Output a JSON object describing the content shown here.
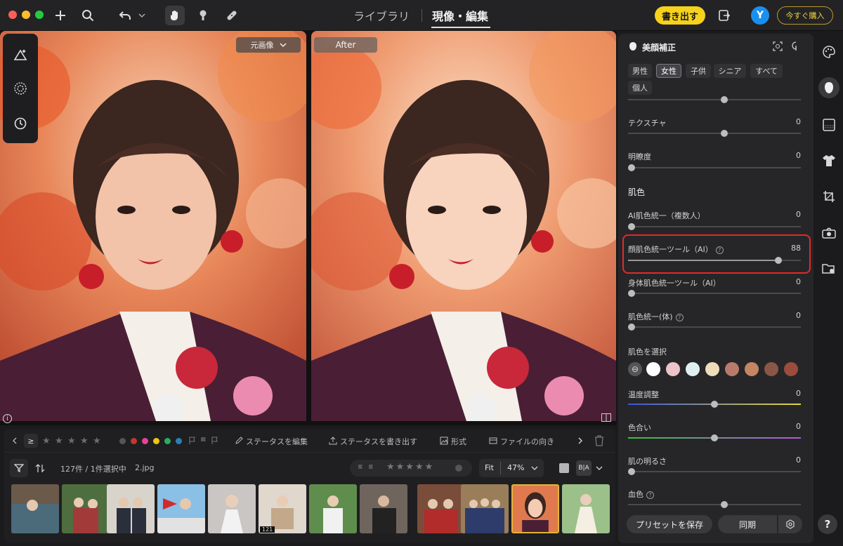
{
  "topbar": {
    "nav_library": "ライブラリ",
    "nav_develop": "現像・編集",
    "export_label": "書き出す",
    "avatar_letter": "Y",
    "buy_label": "今すぐ購入"
  },
  "viewer": {
    "original_dropdown": "元画像",
    "after_label": "After"
  },
  "filmstrip": {
    "edit_status": "ステータスを編集",
    "export_status": "ステータスを書き出す",
    "format": "形式",
    "file_orientation": "ファイルの向き",
    "count_text": "127件 / 1件選択中",
    "file_name": "2.jpg",
    "fit_label": "Fit",
    "zoom_value": "47%",
    "ba_label": "B|A",
    "thumb_badge": "121",
    "color_labels": [
      "#c0392b",
      "#e84393",
      "#f1c40f",
      "#27ae60",
      "#2980b9"
    ]
  },
  "panel": {
    "title": "美顔補正",
    "chips": [
      "男性",
      "女性",
      "子供",
      "シニア",
      "すべて",
      "個人"
    ],
    "active_chip": "女性",
    "texture_label": "テクスチャ",
    "texture_value": "0",
    "clarity_label": "明瞭度",
    "clarity_value": "0",
    "skin_section": "肌色",
    "ai_skin_unify_label": "AI肌色統一（複数人）",
    "ai_skin_unify_value": "0",
    "face_skin_tool_label": "顔肌色統一ツール（AI）",
    "face_skin_tool_value": "88",
    "body_skin_tool_label": "身体肌色統一ツール（AI）",
    "body_skin_tool_value": "0",
    "skin_unify_body_label": "肌色統一(体)",
    "skin_unify_body_value": "0",
    "select_skin_label": "肌色を選択",
    "skin_swatches": [
      "#ffffff",
      "#ecc3c8",
      "#def0f2",
      "#efdcbb",
      "#b97a6c",
      "#c48563",
      "#8a5648",
      "#9b4c3c"
    ],
    "temp_label": "温度調整",
    "temp_value": "0",
    "tint_label": "色合い",
    "tint_value": "0",
    "brightness_label": "肌の明るさ",
    "brightness_value": "0",
    "blood_label": "血色",
    "preset_save": "プリセットを保存",
    "sync_label": "同期"
  }
}
